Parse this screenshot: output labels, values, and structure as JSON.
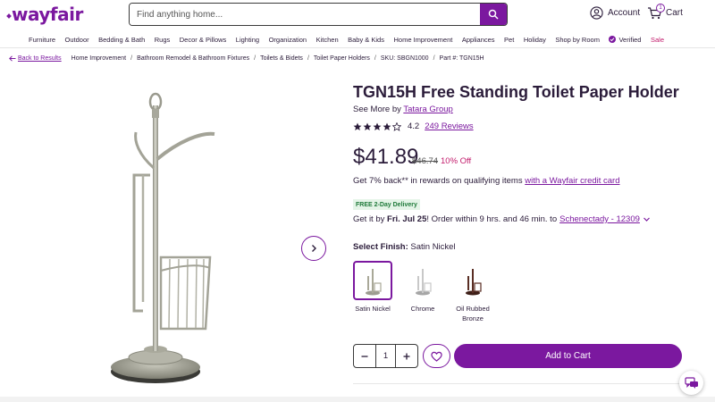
{
  "brand": {
    "logo_text": "wayfair",
    "color": "#7b189f"
  },
  "header": {
    "search_placeholder": "Find anything home...",
    "account_label": "Account",
    "cart_label": "Cart",
    "cart_count": "1"
  },
  "nav": {
    "items": [
      "Furniture",
      "Outdoor",
      "Bedding & Bath",
      "Rugs",
      "Decor & Pillows",
      "Lighting",
      "Organization",
      "Kitchen",
      "Baby & Kids",
      "Home Improvement",
      "Appliances",
      "Pet",
      "Holiday",
      "Shop by Room"
    ],
    "verified_label": "Verified",
    "sale_label": "Sale"
  },
  "breadcrumb": {
    "back_label": "Back to Results",
    "items": [
      "Home Improvement",
      "Bathroom Remodel & Bathroom Fixtures",
      "Toilets & Bidets",
      "Toilet Paper Holders"
    ],
    "sku": "SKU: SBGN1000",
    "part": "Part #: TGN15H"
  },
  "product": {
    "title": "TGN15H Free Standing Toilet Paper Holder",
    "see_more_prefix": "See More by",
    "brand_link": "Tatara Group",
    "rating_value": "4.2",
    "rating": 4.2,
    "reviews_label": "249 Reviews",
    "price": "$41.89",
    "old_price": "$46.74",
    "discount": "10% Off",
    "rewards_text": "Get 7% back** in rewards on qualifying items",
    "rewards_link": "with a Wayfair credit card",
    "shipping_badge": "FREE 2-Day Delivery",
    "delivery_prefix": "Get it by",
    "delivery_date": "Fri. Jul 25",
    "delivery_suffix": "! Order within 9 hrs. and 46 min. to",
    "delivery_location": "Schenectady - 12309",
    "finish_label": "Select Finish:",
    "finish_selected": "Satin Nickel",
    "finishes": [
      {
        "name": "Satin Nickel",
        "color": "#a9a898"
      },
      {
        "name": "Chrome",
        "color": "#c8c8c8"
      },
      {
        "name": "Oil Rubbed Bronze",
        "color": "#5a2e24"
      }
    ],
    "quantity": "1",
    "add_to_cart_label": "Add to Cart"
  },
  "colors": {
    "accent": "#7b189f",
    "sale": "#c21a6b",
    "ship_green": "#1f7a3a"
  }
}
